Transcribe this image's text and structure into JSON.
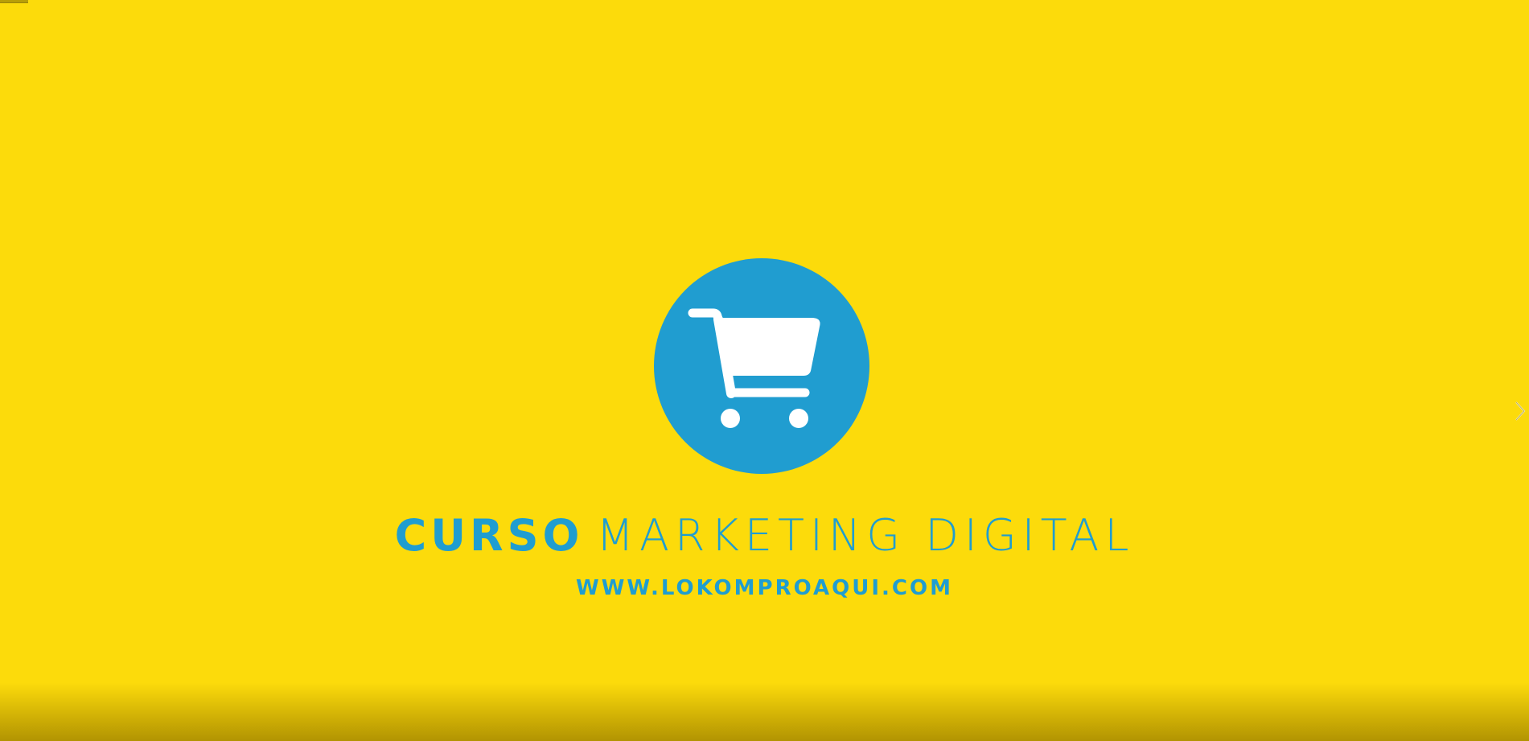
{
  "slide": {
    "title_bold": "CURSO",
    "title_light": "MARKETING DIGITAL",
    "url": "WWW.LOKOMPROAQUI.COM",
    "logo_icon": "shopping-cart-icon",
    "next_icon": "chevron-right-icon"
  },
  "colors": {
    "background": "#FCDB0B",
    "accent": "#209DD0",
    "icon": "#FFFFFF"
  }
}
